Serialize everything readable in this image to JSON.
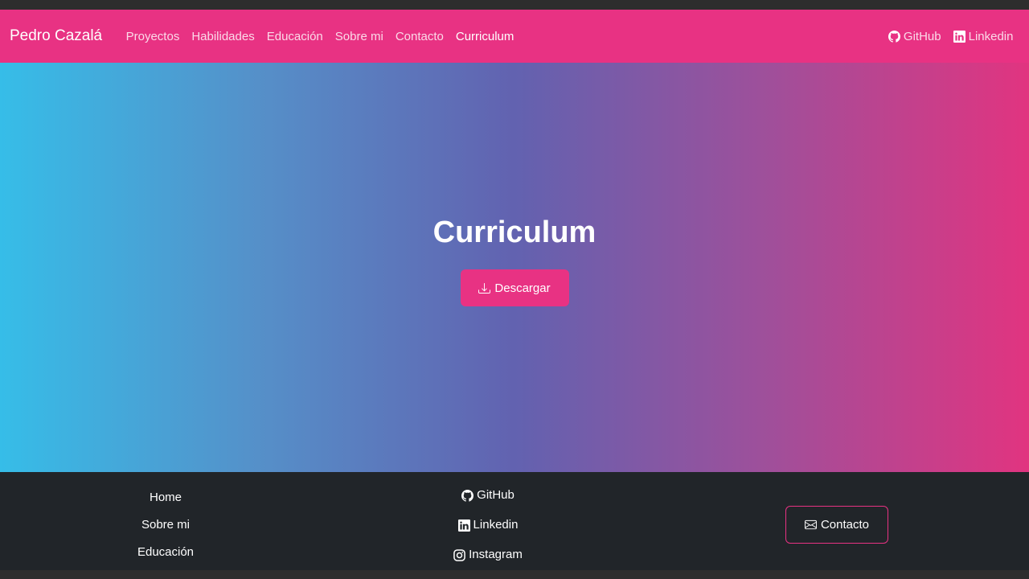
{
  "navbar": {
    "brand": "Pedro Cazalá",
    "links": [
      {
        "label": "Proyectos"
      },
      {
        "label": "Habilidades"
      },
      {
        "label": "Educación"
      },
      {
        "label": "Sobre mi"
      },
      {
        "label": "Contacto"
      },
      {
        "label": "Curriculum",
        "active": true
      }
    ],
    "right": [
      {
        "label": "GitHub",
        "icon": "github-icon"
      },
      {
        "label": "Linkedin",
        "icon": "linkedin-icon"
      }
    ]
  },
  "hero": {
    "title": "Curriculum",
    "download_label": "Descargar",
    "download_icon": "download-icon"
  },
  "footer": {
    "nav": [
      {
        "label": "Home"
      },
      {
        "label": "Sobre mi"
      },
      {
        "label": "Educación"
      }
    ],
    "social": [
      {
        "label": "GitHub",
        "icon": "github-icon"
      },
      {
        "label": "Linkedin",
        "icon": "linkedin-icon"
      },
      {
        "label": "Instagram",
        "icon": "instagram-icon"
      }
    ],
    "contact_label": "Contacto",
    "contact_icon": "envelope-icon"
  },
  "colors": {
    "accent": "#e83283",
    "footer_bg": "#212529",
    "gradient_start": "#36bde8",
    "gradient_end": "#e13480"
  }
}
